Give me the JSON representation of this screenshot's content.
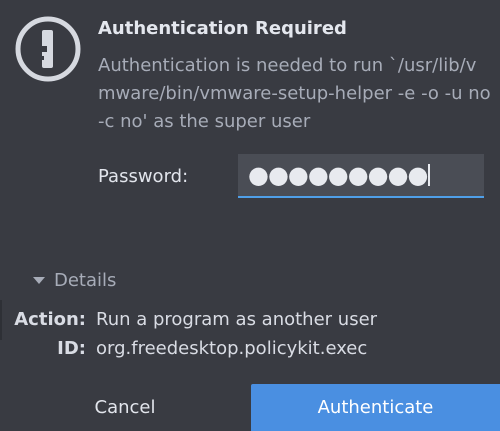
{
  "dialog": {
    "title": "Authentication Required",
    "message": "Authentication is needed to run `/usr/lib/vmware/bin/vmware-setup-helper -e -o -u no -c no' as the super user",
    "icon": "lock-icon"
  },
  "password": {
    "label": "Password:",
    "masked_value": "●●●●●●●●●",
    "accent_color": "#4f9fe8"
  },
  "details": {
    "toggle_label": "Details",
    "action_key": "Action:",
    "action_value": "Run a program as another user",
    "id_key": "ID:",
    "id_value": "org.freedesktop.policykit.exec"
  },
  "buttons": {
    "cancel_label": "Cancel",
    "authenticate_label": "Authenticate",
    "authenticate_color": "#4a8fe1"
  }
}
